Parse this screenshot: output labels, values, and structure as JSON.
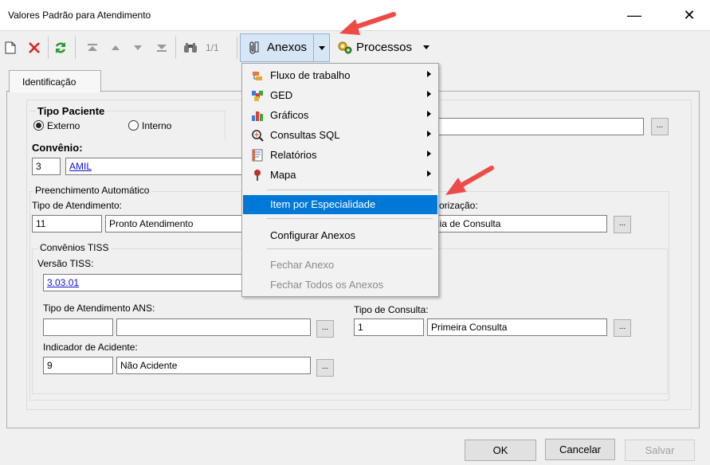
{
  "window": {
    "title": "Valores Padrão para Atendimento",
    "minimize_glyph": "—",
    "close_glyph": "✕"
  },
  "toolbar": {
    "record_counter": "1/1",
    "anexos_label": "Anexos",
    "processos_label": "Processos",
    "icons": [
      "new-icon",
      "delete-icon",
      "refresh-icon",
      "first-icon",
      "previous-icon",
      "next-icon",
      "last-icon",
      "find-icon",
      "paperclip-icon",
      "gears-icon"
    ]
  },
  "tabs": [
    {
      "label": "Identificação"
    }
  ],
  "form": {
    "tipo_paciente": {
      "label": "Tipo Paciente",
      "options": [
        "Externo",
        "Interno"
      ],
      "selected": "Externo"
    },
    "convenio": {
      "label": "Convênio:",
      "code": "3",
      "name": "AMIL"
    },
    "preenchimento": {
      "legend": "Preenchimento Automático",
      "tipo_atendimento": {
        "label": "Tipo de Atendimento:",
        "code": "11",
        "name": "Pronto Atendimento"
      },
      "autorizacao": {
        "label_fragment": "orização:",
        "value_fragment": "uia de Consulta"
      }
    },
    "tiss": {
      "legend": "Convênios TISS",
      "versao": {
        "label": "Versão TISS:",
        "value": "3.03.01"
      },
      "tipo_atendimento_ans": {
        "label": "Tipo de Atendimento ANS:",
        "code": "",
        "name": ""
      },
      "tipo_consulta": {
        "label": "Tipo de Consulta:",
        "code": "1",
        "name": "Primeira Consulta"
      },
      "indicador_acidente": {
        "label": "Indicador de Acidente:",
        "code": "9",
        "name": "Não Acidente"
      }
    },
    "ellipsis": "..."
  },
  "anexos_menu": {
    "items": [
      {
        "label": "Fluxo de trabalho",
        "icon": "workflow-icon",
        "submenu": true
      },
      {
        "label": "GED",
        "icon": "ged-icon",
        "submenu": true
      },
      {
        "label": "Gráficos",
        "icon": "chart-icon",
        "submenu": true
      },
      {
        "label": "Consultas SQL",
        "icon": "sql-query-icon",
        "submenu": true
      },
      {
        "label": "Relatórios",
        "icon": "report-icon",
        "submenu": true
      },
      {
        "label": "Mapa",
        "icon": "map-pin-icon",
        "submenu": true
      }
    ],
    "highlighted": "Item por Especialidade",
    "configurar": "Configurar Anexos",
    "fechar": "Fechar Anexo",
    "fechar_todos": "Fechar Todos os Anexos"
  },
  "buttons": {
    "ok": "OK",
    "cancelar": "Cancelar",
    "salvar": "Salvar"
  },
  "colors": {
    "highlight": "#0078d7",
    "link": "#1010d0",
    "annotation_arrow": "#ee4b47",
    "delete": "#e02020",
    "refresh": "#2a9a2a"
  }
}
